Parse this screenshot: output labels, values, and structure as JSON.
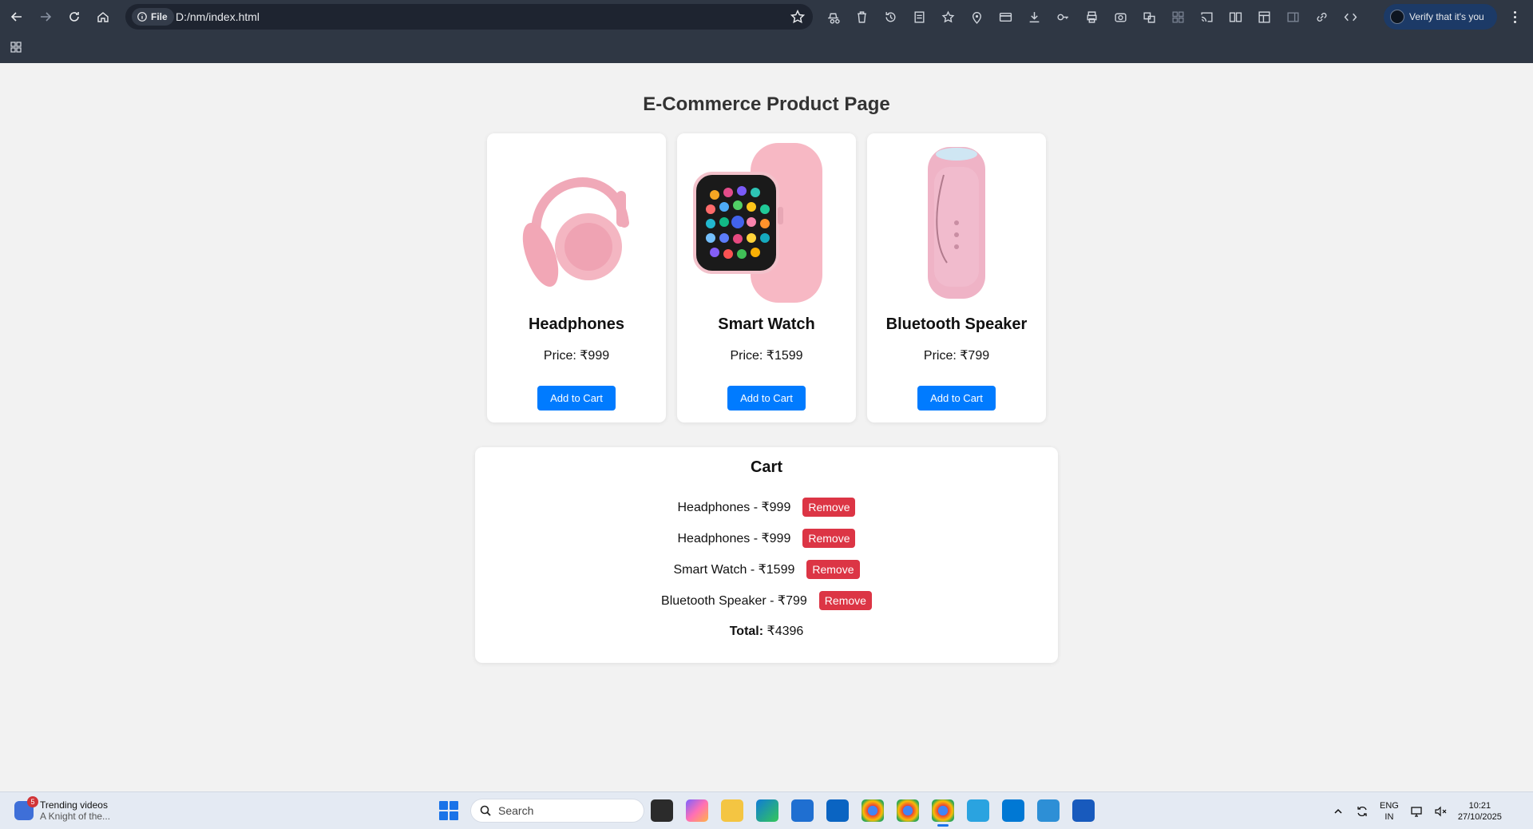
{
  "browser": {
    "site_chip": "File",
    "url": "D:/nm/index.html",
    "verify_label": "Verify that it's you"
  },
  "page": {
    "title": "E-Commerce Product Page",
    "products": [
      {
        "name": "Headphones",
        "price": "Price: ₹999",
        "button": "Add to Cart",
        "color": "#f4b6c2"
      },
      {
        "name": "Smart Watch",
        "price": "Price: ₹1599",
        "button": "Add to Cart",
        "color": "#f7b8c4"
      },
      {
        "name": "Bluetooth Speaker",
        "price": "Price: ₹799",
        "button": "Add to Cart",
        "color": "#efb3c6"
      }
    ],
    "cart": {
      "title": "Cart",
      "items": [
        {
          "label": "Headphones - ₹999",
          "button": "Remove"
        },
        {
          "label": "Headphones - ₹999",
          "button": "Remove"
        },
        {
          "label": "Smart Watch - ₹1599",
          "button": "Remove"
        },
        {
          "label": "Bluetooth Speaker - ₹799",
          "button": "Remove"
        }
      ],
      "total_label": "Total:",
      "total_value": "₹4396"
    }
  },
  "taskbar": {
    "widget_title": "Trending videos",
    "widget_subtitle": "A Knight of the...",
    "widget_badge": "5",
    "search_placeholder": "Search",
    "lang_line1": "ENG",
    "lang_line2": "IN",
    "time": "10:21",
    "date": "27/10/2025"
  },
  "colors": {
    "primary_button": "#007bff",
    "danger_button": "#dc3545",
    "page_background": "#f2f2f2",
    "chrome_background": "#2f3744"
  }
}
